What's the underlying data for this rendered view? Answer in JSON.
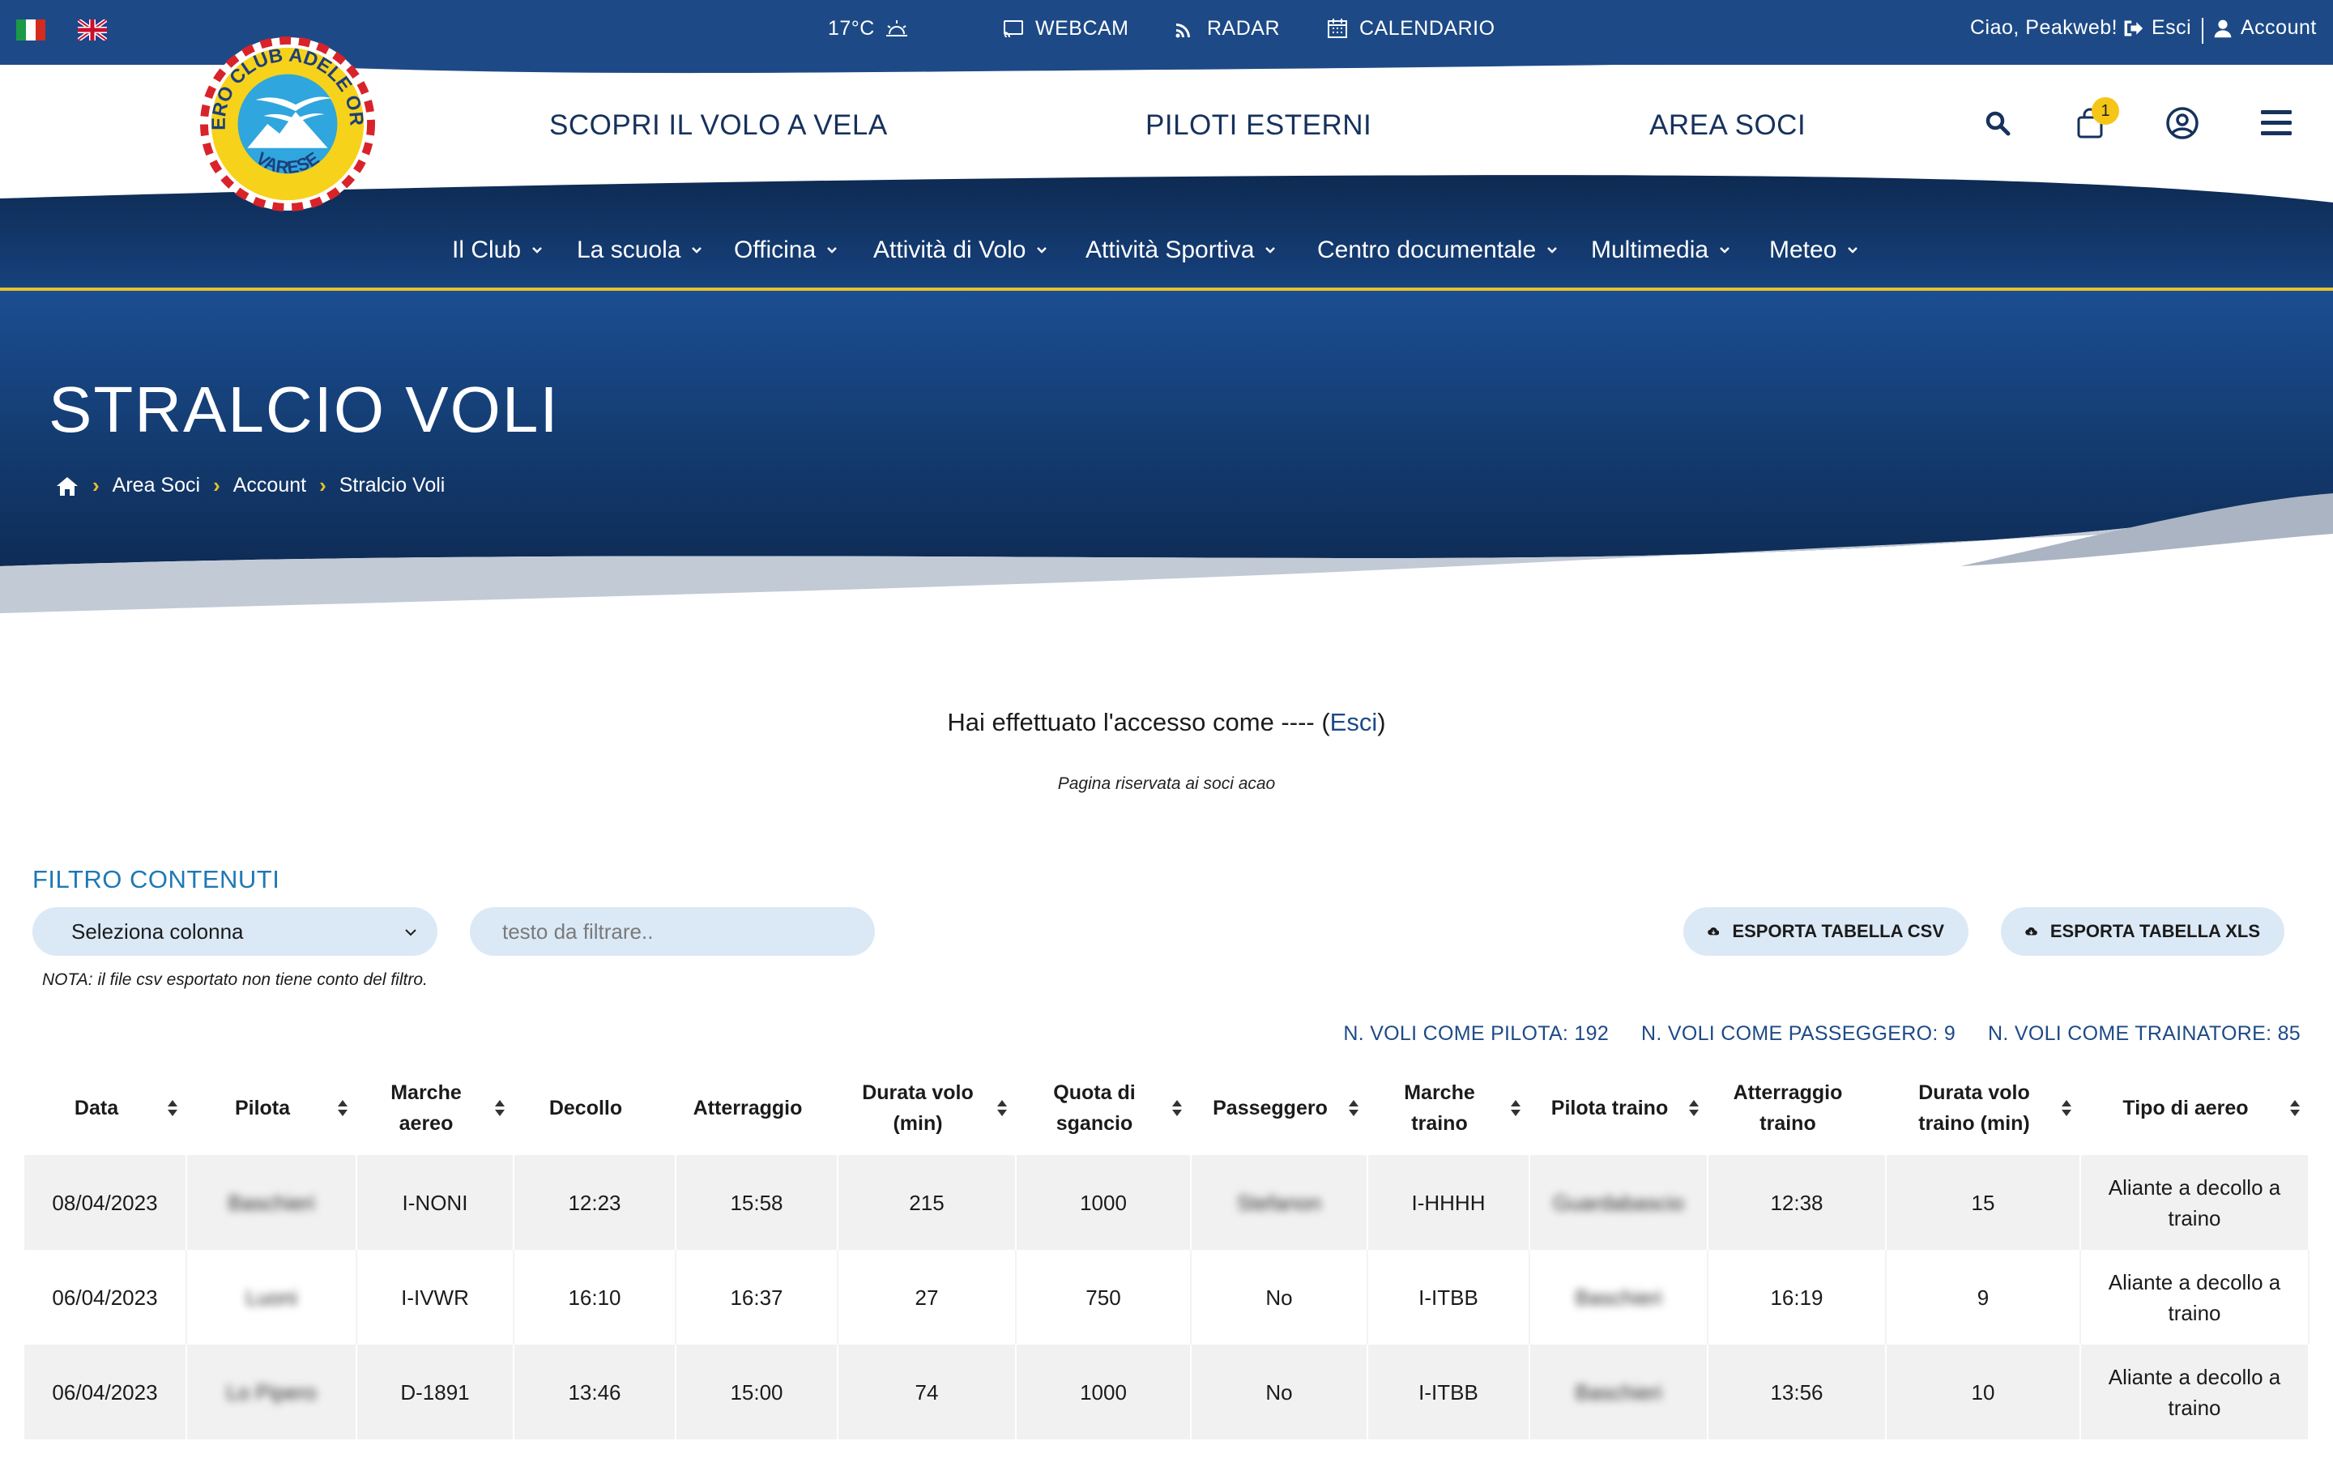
{
  "topbar": {
    "temperature": "17°C",
    "webcam": "WEBCAM",
    "radar": "RADAR",
    "calendar": "CALENDARIO",
    "greeting": "Ciao, Peakweb!",
    "logout": "Esci",
    "account": "Account"
  },
  "logo": {
    "ring_text": "AERO CLUB ADELE ORSI",
    "city_text": "VARESE"
  },
  "header": {
    "nav": [
      "SCOPRI IL VOLO A VELA",
      "PILOTI ESTERNI",
      "AREA SOCI"
    ],
    "cart_count": "1"
  },
  "subnav": [
    "Il Club",
    "La scuola",
    "Officina",
    "Attività di Volo",
    "Attività Sportiva",
    "Centro documentale",
    "Multimedia",
    "Meteo"
  ],
  "hero": {
    "title": "STRALCIO VOLI",
    "breadcrumb": [
      "Area Soci",
      "Account",
      "Stralcio Voli"
    ]
  },
  "content": {
    "login_prefix": "Hai effettuato l'accesso come ---- (",
    "login_link": "Esci",
    "login_suffix": ")",
    "reserved_note": "Pagina riservata ai soci acao",
    "filter_title": "FILTRO CONTENUTI",
    "select_value": "Seleziona colonna",
    "filter_placeholder": "testo da filtrare..",
    "export_csv": "ESPORTA TABELLA CSV",
    "export_xls": "ESPORTA TABELLA XLS",
    "csv_note": "NOTA: il file csv esportato non tiene conto del filtro.",
    "count_pilot": "N. VOLI COME PILOTA: 192",
    "count_passenger": "N. VOLI COME PASSEGGERO: 9",
    "count_tow": "N. VOLI COME TRAINATORE: 85"
  },
  "table": {
    "headers": [
      "Data",
      "Pilota",
      "Marche aereo",
      "Decollo",
      "Atterraggio",
      "Durata volo (min)",
      "Quota di sgancio",
      "Passeggero",
      "Marche traino",
      "Pilota traino",
      "Atterraggio traino",
      "Durata volo traino (min)",
      "Tipo di aereo"
    ],
    "rows": [
      [
        "08/04/2023",
        "Baschieri",
        "I-NONI",
        "12:23",
        "15:58",
        "215",
        "1000",
        "Stefanon",
        "I-HHHH",
        "Guardabascio",
        "12:38",
        "15",
        "Aliante a decollo a traino"
      ],
      [
        "06/04/2023",
        "Luoni",
        "I-IVWR",
        "16:10",
        "16:37",
        "27",
        "750",
        "No",
        "I-ITBB",
        "Baschieri",
        "16:19",
        "9",
        "Aliante a decollo a traino"
      ],
      [
        "06/04/2023",
        "Lo Pipero",
        "D-1891",
        "13:46",
        "15:00",
        "74",
        "1000",
        "No",
        "I-ITBB",
        "Baschieri",
        "13:56",
        "10",
        "Aliante a decollo a traino"
      ]
    ]
  },
  "colors": {
    "brand_blue": "#1d4a86",
    "nav_dark": "#0f2d57",
    "accent_yellow": "#e7c12a",
    "filter_bg": "#dbe9f6",
    "title_blue": "#1f78b4"
  }
}
